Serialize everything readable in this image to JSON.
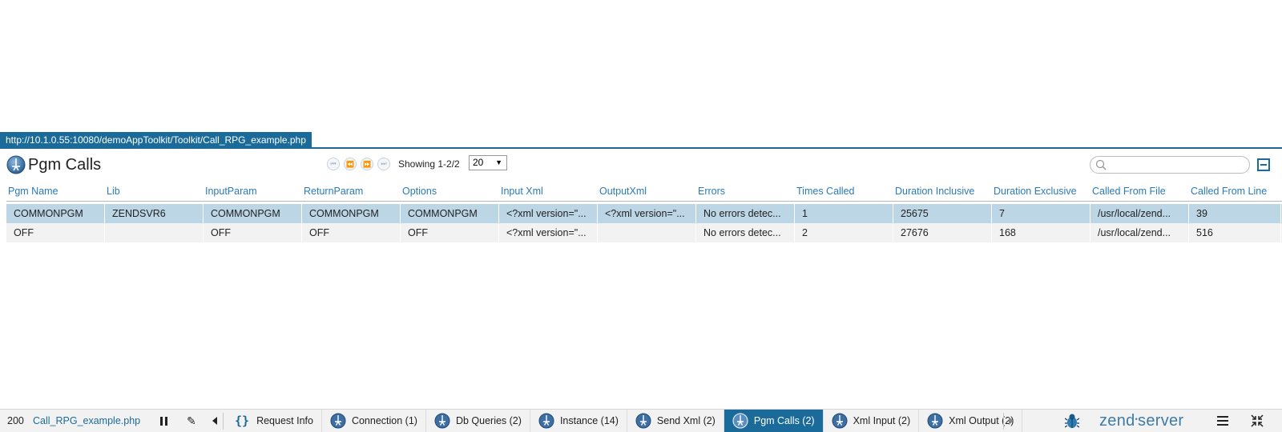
{
  "url": "http://10.1.0.55:10080/demoAppToolkit/Toolkit/Call_RPG_example.php",
  "panel": {
    "title": "Pgm Calls",
    "showing": "Showing 1-2/2",
    "page_size": "20",
    "search_placeholder": ""
  },
  "table": {
    "columns": [
      "Pgm Name",
      "Lib",
      "InputParam",
      "ReturnParam",
      "Options",
      "Input Xml",
      "OutputXml",
      "Errors",
      "Times Called",
      "Duration Inclusive",
      "Duration Exclusive",
      "Called From File",
      "Called From Line"
    ],
    "rows": [
      [
        "COMMONPGM",
        "ZENDSVR6",
        "COMMONPGM",
        "COMMONPGM",
        "COMMONPGM",
        "<?xml version=\"...",
        "<?xml version=\"...",
        "No errors detec...",
        "1",
        "25675",
        "7",
        "/usr/local/zend...",
        "39"
      ],
      [
        "OFF",
        "",
        "OFF",
        "OFF",
        "OFF",
        "<?xml version=\"...",
        "",
        "No errors detec...",
        "2",
        "27676",
        "168",
        "/usr/local/zend...",
        "516"
      ]
    ]
  },
  "toolbar": {
    "status_code": "200",
    "file": "Call_RPG_example.php",
    "tabs": [
      {
        "label": "Request Info",
        "icon": "braces-icon"
      },
      {
        "label": "Connection (1)",
        "icon": "globe-icon"
      },
      {
        "label": "Db Queries (2)",
        "icon": "globe-icon"
      },
      {
        "label": "Instance (14)",
        "icon": "globe-icon"
      },
      {
        "label": "Send Xml (2)",
        "icon": "globe-icon"
      },
      {
        "label": "Pgm Calls (2)",
        "icon": "globe-icon"
      },
      {
        "label": "Xml Input (2)",
        "icon": "globe-icon"
      },
      {
        "label": "Xml Output (2)",
        "icon": "globe-icon"
      }
    ],
    "active_tab": "Pgm Calls (2)",
    "brand_word1": "zend",
    "brand_word2": "server"
  },
  "colors": {
    "accent": "#1a6b9a",
    "selected_row": "#bcd6e6",
    "header_text": "#2a7ab8"
  }
}
